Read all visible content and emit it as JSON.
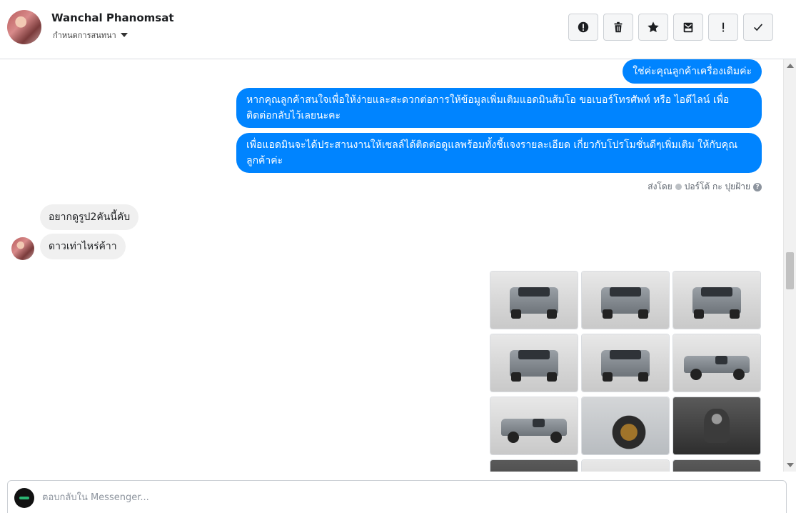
{
  "contact": {
    "name": "Wanchal Phanomsat",
    "assign_label": "กำหนดการสนทนา"
  },
  "toolbar": {
    "buttons": [
      {
        "name": "report-spam",
        "icon": "alert-circle-icon"
      },
      {
        "name": "delete",
        "icon": "trash-icon"
      },
      {
        "name": "star",
        "icon": "star-icon"
      },
      {
        "name": "mark-unread",
        "icon": "envelope-icon"
      },
      {
        "name": "follow-up",
        "icon": "exclamation-icon"
      },
      {
        "name": "mark-done",
        "icon": "check-icon"
      }
    ]
  },
  "messages": {
    "outgoing": [
      "ใช่ค่ะคุณลูกค้าเครื่องเดิมค่ะ",
      "หากคุณลูกค้าสนใจเพื่อให้ง่ายและสะดวกต่อการให้ข้อมูลเพิ่มเติมแอดมินส้มโอ ขอเบอร์โทรศัพท์ หรือ ไอดีไลน์ เพื่อติดต่อกลับไว้เลยนะคะ",
      "เพื่อแอดมินจะได้ประสานงานให้เซลล์ได้ติดต่อดูแลพร้อมทั้งชี้แจงรายละเอียด เกี่ยวกับโปรโมชั่นดีๆเพิ่มเติม ให้กับคุณลูกค้าค่ะ"
    ],
    "sent_by_label": "ส่งโดย",
    "sent_by_name": "ปอร์โต้ กะ ปุยฝ้าย",
    "incoming": [
      "อยากดูรูป2คันนี้คับ",
      "ดาวเท่าไหร่ค้าา"
    ]
  },
  "photos": [
    {
      "label": "truck-front",
      "style": "front"
    },
    {
      "label": "truck-front-angle",
      "style": "front"
    },
    {
      "label": "truck-rear-angle",
      "style": "front"
    },
    {
      "label": "truck-rear",
      "style": "front"
    },
    {
      "label": "truck-rear-angle-2",
      "style": "front"
    },
    {
      "label": "truck-side-right",
      "style": "side"
    },
    {
      "label": "truck-side-left",
      "style": "side"
    },
    {
      "label": "truck-wheel",
      "style": "wheel"
    },
    {
      "label": "truck-gear-shift",
      "style": "dark"
    },
    {
      "label": "truck-interior-1",
      "style": "dark"
    },
    {
      "label": "truck-interior-2",
      "style": "side"
    },
    {
      "label": "truck-interior-3",
      "style": "dark"
    }
  ],
  "reply": {
    "placeholder": "ตอบกลับใน Messenger..."
  },
  "colors": {
    "outgoing_bubble": "#0084ff",
    "incoming_bubble": "#f0f0f0"
  }
}
